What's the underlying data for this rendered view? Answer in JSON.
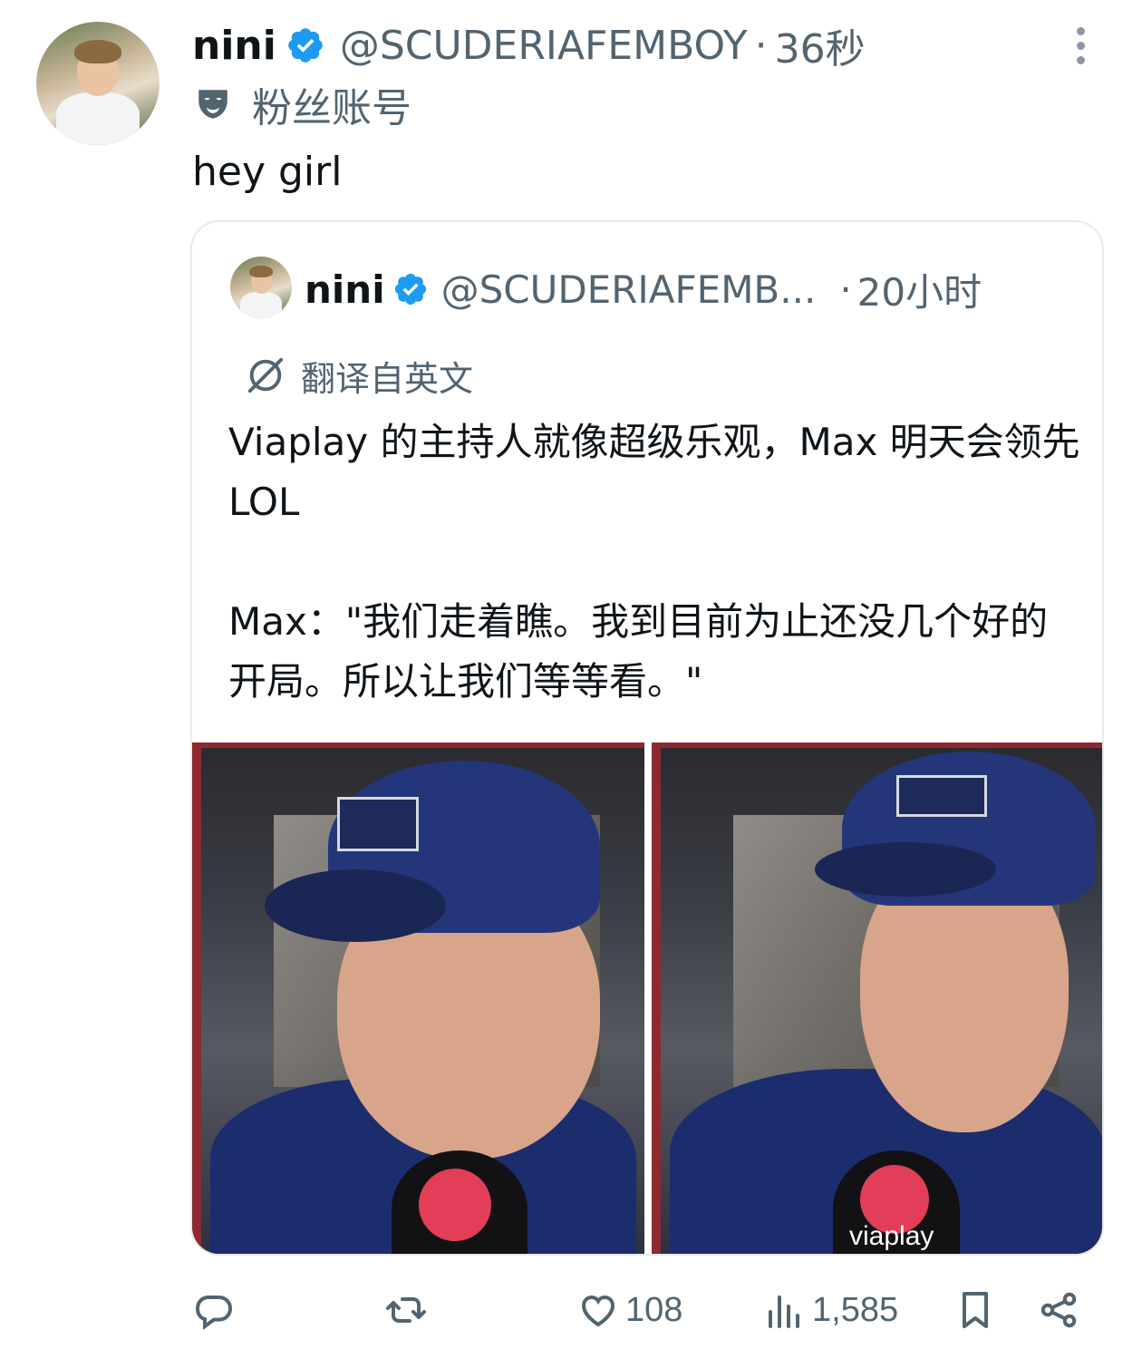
{
  "tweet": {
    "author_name": "nini",
    "handle": "@SCUDERIAFEMBOY",
    "separator": "·",
    "time": "36秒",
    "label": "粉丝账号",
    "text": "hey girl"
  },
  "quote": {
    "author_name": "nini",
    "handle": "@SCUDERIAFEMB...",
    "separator": "·",
    "time": "20小时",
    "translation_label": "翻译自英文",
    "paragraph_1": "Viaplay 的主持人就像超级乐观，Max 明天会领先 LOL",
    "paragraph_2": "Max：\"我们走着瞧。我到目前为止还没几个好的开局。所以让我们等等看。\""
  },
  "media": {
    "mic_brand": "viaplay"
  },
  "actions": {
    "likes": "108",
    "views": "1,585"
  },
  "colors": {
    "verified": "#1d9bf0",
    "secondary_text": "#536471",
    "border": "#e7eaed"
  }
}
